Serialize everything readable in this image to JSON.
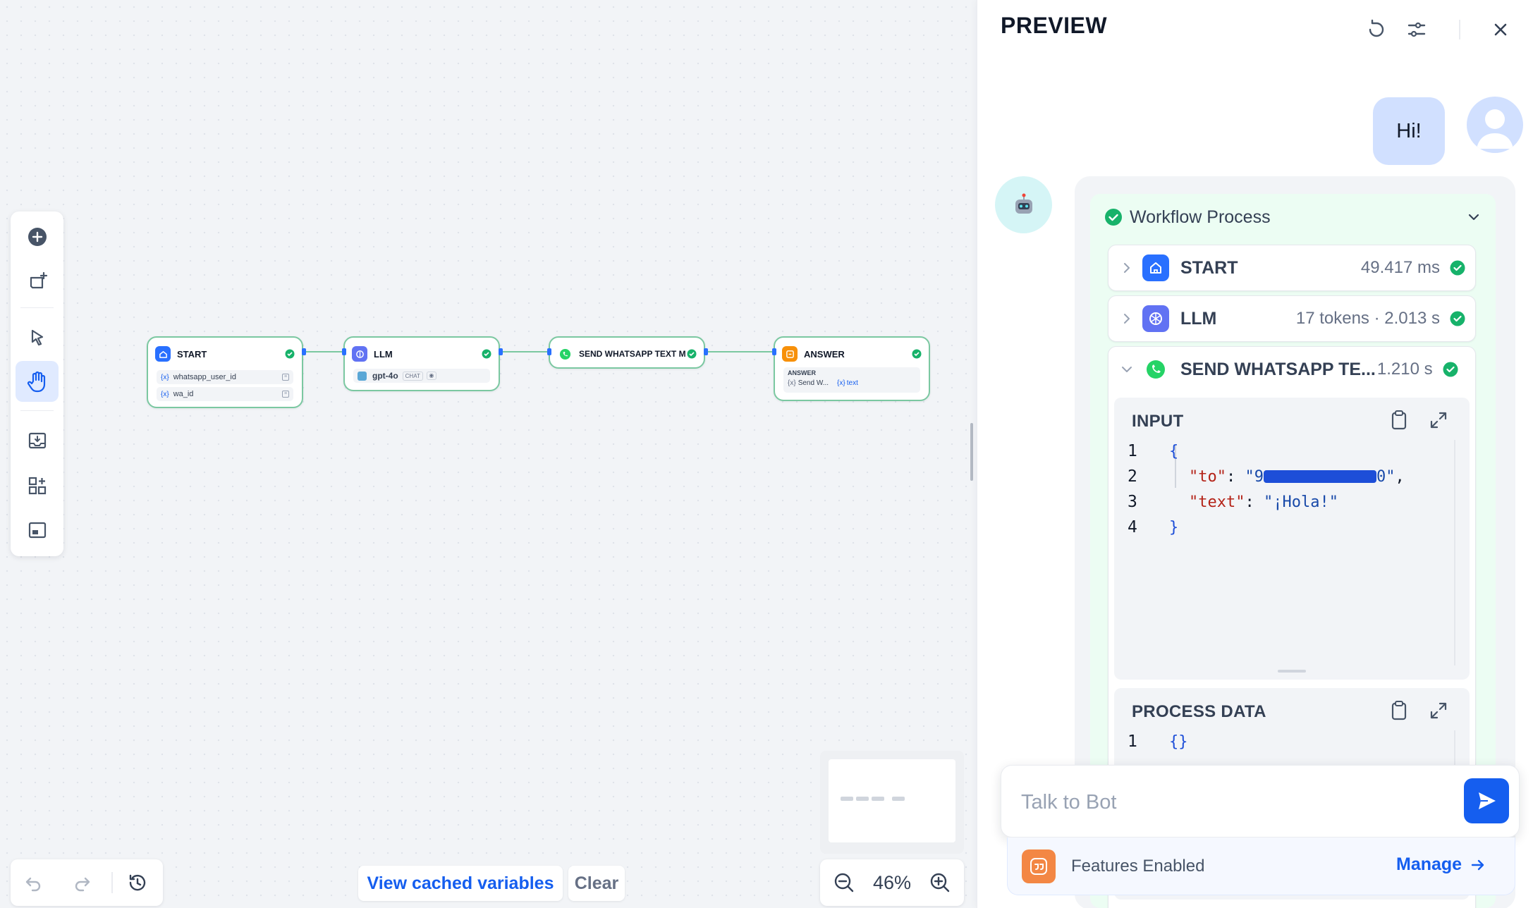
{
  "canvas": {
    "nodes": {
      "start": {
        "title": "START",
        "vars": [
          "whatsapp_user_id",
          "wa_id"
        ]
      },
      "llm": {
        "title": "LLM",
        "model": "gpt-4o",
        "mode": "CHAT"
      },
      "whatsapp": {
        "title": "SEND WHATSAPP TEXT M"
      },
      "answer": {
        "title": "ANSWER",
        "field_label": "ANSWER",
        "ref_node": "Send W...",
        "ref_var": "text"
      }
    },
    "zoom": "46%",
    "view_cached_label": "View cached variables",
    "clear_label": "Clear"
  },
  "preview": {
    "title": "PREVIEW",
    "user_message": "Hi!",
    "workflow": {
      "title": "Workflow Process",
      "steps": [
        {
          "name": "START",
          "meta": "49.417 ms"
        },
        {
          "name": "LLM",
          "meta": "17 tokens · 2.013 s"
        },
        {
          "name": "SEND WHATSAPP TE...",
          "meta": "1.210 s"
        }
      ],
      "input_title": "INPUT",
      "input_lines": {
        "l1": "1",
        "l2": "2",
        "l3": "3",
        "l4": "4",
        "open": "{",
        "to_key": "\"to\"",
        "to_val_prefix": "\"9",
        "to_val_suffix": "0\"",
        "text_key": "\"text\"",
        "text_val": "\"¡Hola!\"",
        "close": "}"
      },
      "process_title": "PROCESS DATA",
      "process_line_no": "1",
      "process_value": "{}"
    },
    "input_placeholder": "Talk to Bot",
    "features_label": "Features Enabled",
    "manage_label": "Manage"
  },
  "colors": {
    "accent": "#155eef",
    "success": "#17b26a",
    "edge": "#7bc8a1",
    "start_icon": "#2970ff",
    "llm_icon": "#6172f3",
    "whatsapp": "#25d366",
    "answer_icon": "#f79009"
  }
}
